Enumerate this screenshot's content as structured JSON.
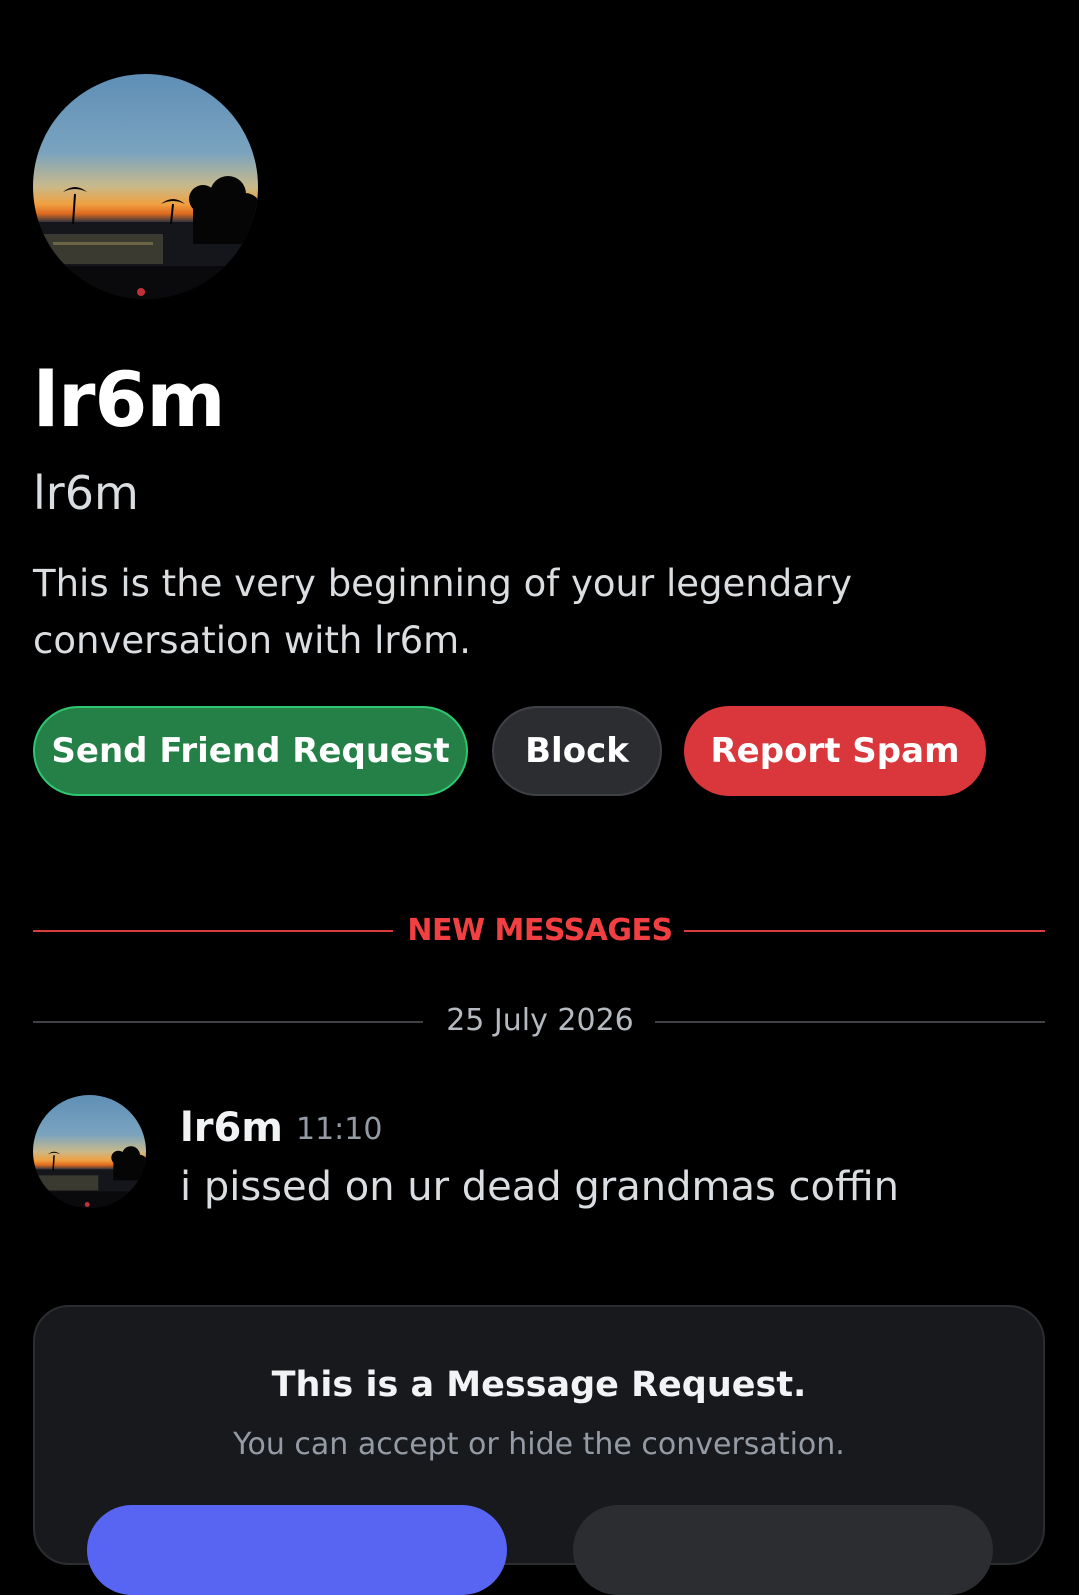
{
  "profile": {
    "display_name": "lr6m",
    "username": "lr6m",
    "intro_line1": "This is the very beginning of your legendary",
    "intro_line2": "conversation with lr6m."
  },
  "actions": {
    "send_friend_request": "Send Friend Request",
    "block": "Block",
    "report_spam": "Report Spam"
  },
  "dividers": {
    "new_messages": "NEW MESSAGES",
    "date": "25 July 2026"
  },
  "message": {
    "author": "lr6m",
    "time": "11:10",
    "text": "i pissed on ur dead grandmas coffin"
  },
  "request": {
    "title": "This is a Message Request.",
    "subtitle": "You can accept or hide the conversation."
  },
  "colors": {
    "background": "#000000",
    "friend_green": "#248046",
    "spam_red": "#da373c",
    "new_messages_red": "#f23f42",
    "accept_blurple": "#5865f2"
  }
}
